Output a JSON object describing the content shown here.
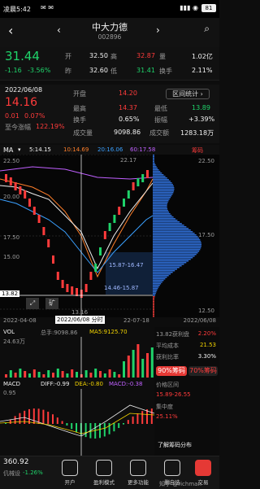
{
  "status_bar": {
    "time": "凌晨5:42",
    "battery": "81"
  },
  "header": {
    "title": "中大力德",
    "code": "002896"
  },
  "quote": {
    "price": "31.44",
    "change": "-1.16",
    "change_pct": "-3.56%",
    "open_label": "开",
    "open": "32.50",
    "high_label": "高",
    "high": "32.87",
    "volume_label": "量",
    "volume": "1.02亿",
    "prev_label": "昨",
    "prev": "32.60",
    "low_label": "低",
    "low": "31.41",
    "turnover_label": "换手",
    "turnover": "2.11%"
  },
  "detail": {
    "date": "2022/06/08",
    "price": "14.16",
    "chg": "0.01",
    "chg_pct": "0.07%",
    "since_label": "至今涨幅",
    "since": "122.19%",
    "interval_btn": "区间统计",
    "open_label": "开盘",
    "open": "14.20",
    "high_label": "最高",
    "high": "14.37",
    "low_label": "最低",
    "low": "13.89",
    "turnover_label": "换手",
    "turnover": "0.65%",
    "amp_label": "振幅",
    "amp": "+3.39%",
    "vol_label": "成交量",
    "vol": "9098.86",
    "amount_label": "成交额",
    "amount": "1283.18万"
  },
  "ma_bar": {
    "name": "MA",
    "ma5": "5:14.15",
    "ma10": "10:14.69",
    "ma20": "20:16.06",
    "ma60": "60:17.58",
    "chip_label": "筹码"
  },
  "chart": {
    "y_top": "22.50",
    "y_17": "17.50",
    "y_12": "12.50",
    "y_20": "20.00",
    "y_15": "15.00",
    "y_mid_right": "17.50",
    "y_bot_right": "12.50",
    "pk_label": "22.17",
    "ann1": "15.87-16.47",
    "ann2": "14.46-15.87",
    "cross_price": "13.82",
    "low_label": "13.16",
    "date_start": "2022-04-08",
    "date_cross": "2022/06/08 分时",
    "date_mid": "22-07-18",
    "date_end": "2022/06/08",
    "cross_icon": "矿",
    "expand_icon": "expand-icon",
    "vol_name": "VOL",
    "vol_total": "总手:9098.86",
    "vol_ma5": "MA5:9125.70",
    "vol_top": "24.63万",
    "macd_name": "MACD",
    "diff": "DIFF:-0.99",
    "dea": "DEA:-0.80",
    "macd": "MACD:-0.38",
    "macd_top": "0.95"
  },
  "chip": {
    "profit_label": "13.82获利盘",
    "profit": "2.20%",
    "cost_label": "平均成本",
    "cost": "21.53",
    "ratio_label": "获利比率",
    "ratio": "3.30%",
    "chip90": "90%筹码",
    "chip70": "70%筹码",
    "range_label": "价格区间",
    "range": "15.89-26.55",
    "conc_label": "集中度",
    "conc": "25.11%",
    "learn": "了解筹码分布"
  },
  "tabs": [
    {
      "label": "开户"
    },
    {
      "label": "盈利模式"
    },
    {
      "label": "更多功能"
    },
    {
      "label": "删自选"
    },
    {
      "label": "交易"
    }
  ],
  "ticker": {
    "value": "360.92",
    "name": "仉械设",
    "pct": "-1.26%"
  },
  "watermark": "知乎 @richman",
  "colors": {
    "up": "#ff3b3b",
    "down": "#1fd36a",
    "accent": "#1e6fff"
  }
}
